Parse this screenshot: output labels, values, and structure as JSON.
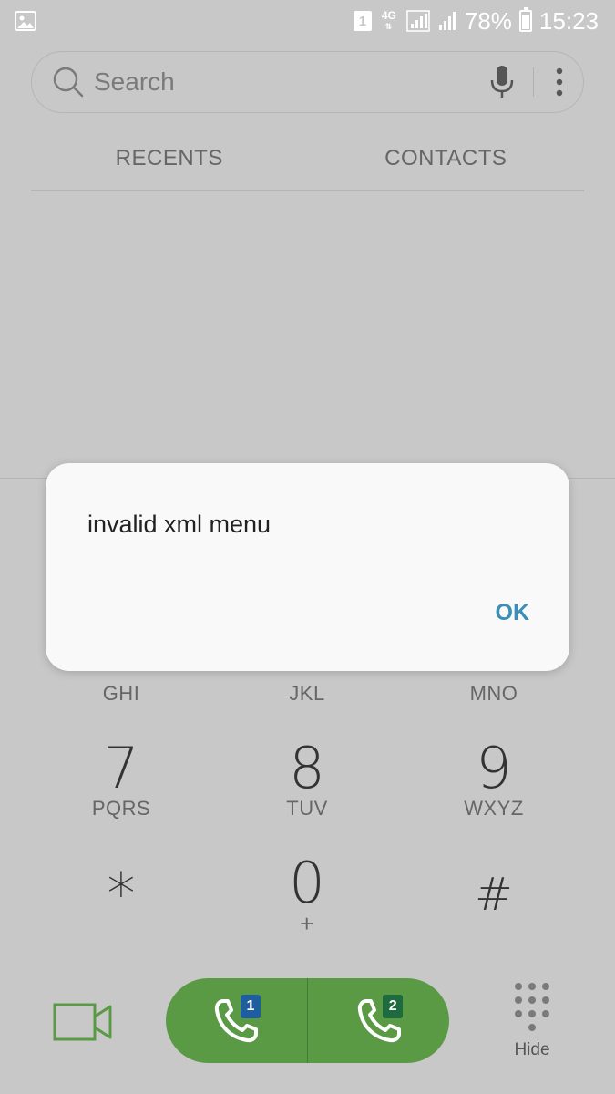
{
  "status_bar": {
    "notification_icon": "gallery-icon",
    "sim_label": "1",
    "network_type": "4G",
    "battery_percent": "78%",
    "time": "15:23"
  },
  "search": {
    "placeholder": "Search",
    "icons": [
      "search-icon",
      "microphone-icon",
      "more-options-icon"
    ]
  },
  "tabs": [
    {
      "label": "RECENTS"
    },
    {
      "label": "CONTACTS"
    }
  ],
  "dialpad": {
    "row3_letters": [
      "GHI",
      "JKL",
      "MNO"
    ],
    "row4": [
      {
        "digit": "7",
        "letters": "PQRS"
      },
      {
        "digit": "8",
        "letters": "TUV"
      },
      {
        "digit": "9",
        "letters": "WXYZ"
      }
    ],
    "row5": [
      {
        "digit": "*",
        "letters": ""
      },
      {
        "digit": "0",
        "letters": "+"
      },
      {
        "digit": "#",
        "letters": ""
      }
    ]
  },
  "bottom_bar": {
    "video_call_icon": "video-camera-icon",
    "call_sim1_label": "1",
    "call_sim2_label": "2",
    "hide_label": "Hide"
  },
  "dialog": {
    "message": "invalid xml menu",
    "ok_label": "OK"
  },
  "colors": {
    "background": "#c8c8c8",
    "call_green": "#5a9a45",
    "sim1_blue": "#1f5e9e",
    "sim2_green": "#1d6b3e",
    "dialog_accent": "#3b8fb6",
    "video_icon_green": "#5a9a45"
  }
}
